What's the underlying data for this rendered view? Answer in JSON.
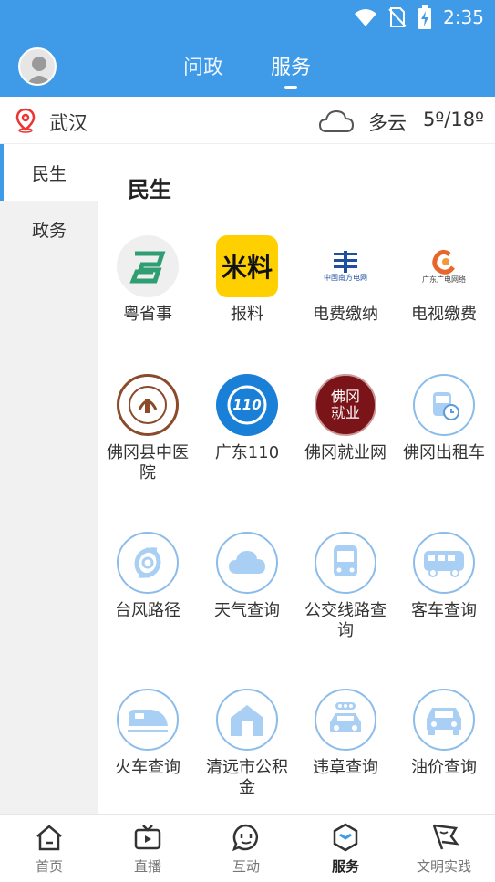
{
  "status_bar": {
    "time": "2:35"
  },
  "header": {
    "tabs": [
      {
        "label": "问政",
        "active": false
      },
      {
        "label": "服务",
        "active": true
      }
    ]
  },
  "location": {
    "city": "武汉",
    "weather": "多云",
    "temperature": "5º/18º"
  },
  "side_nav": {
    "items": [
      {
        "label": "民生",
        "active": true
      },
      {
        "label": "政务",
        "active": false
      }
    ]
  },
  "section": {
    "title": "民生"
  },
  "services": [
    {
      "label": "粤省事",
      "icon": "yueshengshi-logo"
    },
    {
      "label": "报料",
      "icon": "baoliao-logo",
      "logo_text": "料"
    },
    {
      "label": "电费缴纳",
      "icon": "china-southern-power-grid-logo",
      "logo_text": "中国南方电网"
    },
    {
      "label": "电视缴费",
      "icon": "guangdong-cable-tv-logo",
      "logo_text": "广东广电网络"
    },
    {
      "label": "佛冈县中医院",
      "icon": "hospital-logo"
    },
    {
      "label": "广东110",
      "icon": "guangdong-110-logo",
      "logo_text": "110"
    },
    {
      "label": "佛冈就业网",
      "icon": "fogang-employment-logo",
      "logo_text": "佛冈就业"
    },
    {
      "label": "佛冈出租车",
      "icon": "taxi-icon"
    },
    {
      "label": "台风路径",
      "icon": "typhoon-icon"
    },
    {
      "label": "天气查询",
      "icon": "cloud-icon"
    },
    {
      "label": "公交线路查询",
      "icon": "bus-icon"
    },
    {
      "label": "客车查询",
      "icon": "coach-icon"
    },
    {
      "label": "火车查询",
      "icon": "train-icon"
    },
    {
      "label": "清远市公积金",
      "icon": "house-icon"
    },
    {
      "label": "违章查询",
      "icon": "traffic-car-icon"
    },
    {
      "label": "油价查询",
      "icon": "car-icon"
    }
  ],
  "bottom_nav": {
    "items": [
      {
        "label": "首页",
        "icon": "home-icon",
        "active": false
      },
      {
        "label": "直播",
        "icon": "tv-icon",
        "active": false
      },
      {
        "label": "互动",
        "icon": "chat-icon",
        "active": false
      },
      {
        "label": "服务",
        "icon": "service-icon",
        "active": true
      },
      {
        "label": "文明实践",
        "icon": "flag-icon",
        "active": false
      }
    ]
  },
  "colors": {
    "primary": "#3f9ae8",
    "icon_outline": "#8cbcea",
    "icon_fill": "#a9d0f4"
  }
}
